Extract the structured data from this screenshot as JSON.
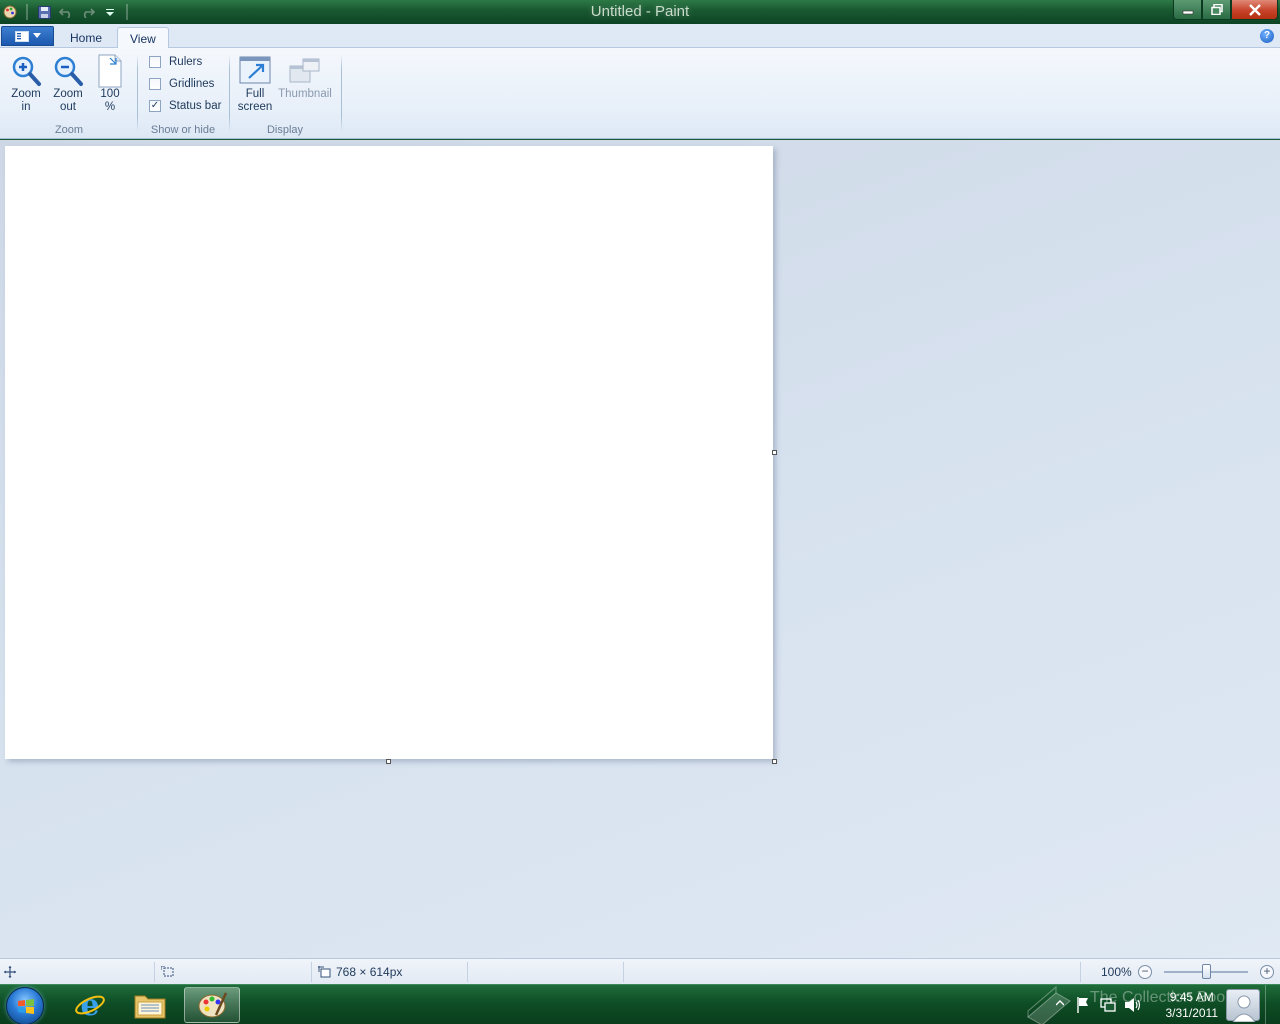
{
  "window": {
    "title": "Untitled - Paint"
  },
  "tabs": {
    "home": "Home",
    "view": "View",
    "active": "View"
  },
  "ribbon": {
    "zoom_group": {
      "label": "Zoom",
      "zoom_in": "Zoom\nin",
      "zoom_in_l1": "Zoom",
      "zoom_in_l2": "in",
      "zoom_out_l1": "Zoom",
      "zoom_out_l2": "out",
      "hundred_l1": "100",
      "hundred_l2": "%"
    },
    "show_hide_group": {
      "label": "Show or hide",
      "rulers": "Rulers",
      "rulers_checked": false,
      "gridlines": "Gridlines",
      "gridlines_checked": false,
      "status_bar": "Status bar",
      "status_bar_checked": true,
      "check_mark": "✓"
    },
    "display_group": {
      "label": "Display",
      "full_screen_l1": "Full",
      "full_screen_l2": "screen",
      "thumbnail": "Thumbnail"
    }
  },
  "statusbar": {
    "canvas_size": "768 × 614px",
    "zoom_level": "100%",
    "zoom_fraction": 0.5
  },
  "taskbar": {
    "time": "9:45 AM",
    "date": "3/31/2011",
    "watermark": "The Collection Book"
  },
  "colors": {
    "accent": "#1c58b0",
    "taskbar": "#0f4e26",
    "workspace": "#d7e2ef"
  }
}
